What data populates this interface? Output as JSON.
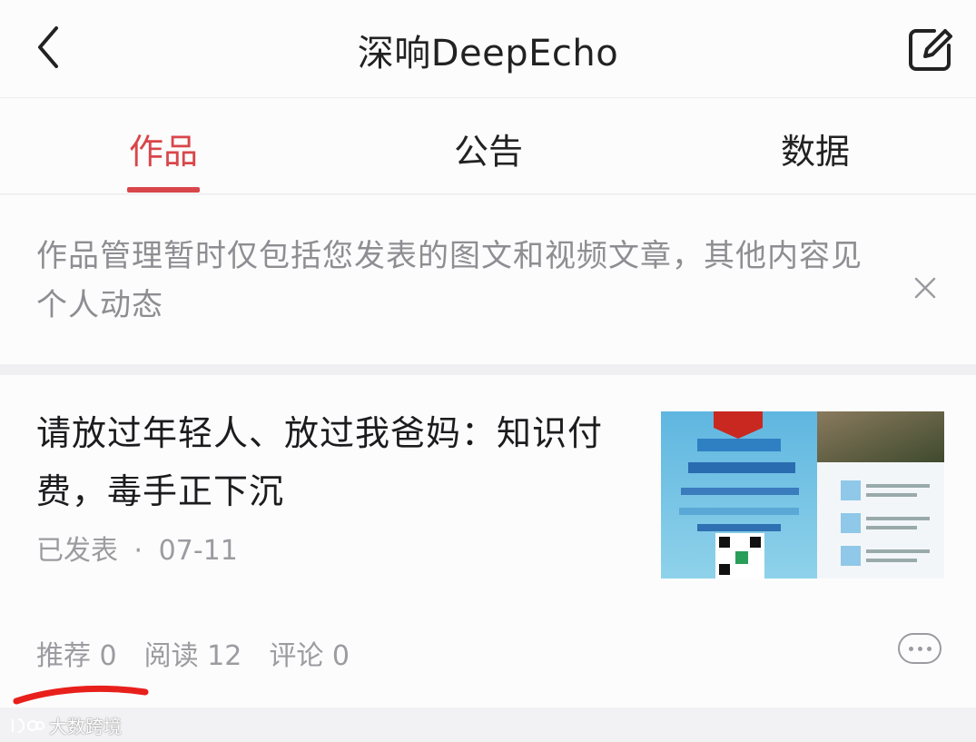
{
  "header": {
    "title": "深响DeepEcho",
    "back_icon": "chevron-left-icon",
    "edit_icon": "edit-icon"
  },
  "tabs": [
    {
      "label": "作品",
      "active": true
    },
    {
      "label": "公告",
      "active": false
    },
    {
      "label": "数据",
      "active": false
    }
  ],
  "notice": {
    "text": "作品管理暂时仅包括您发表的图文和视频文章，其他内容见个人动态",
    "close_icon": "close-icon"
  },
  "article": {
    "title": "请放过年轻人、放过我爸妈：知识付费，毒手正下沉",
    "status": "已发表",
    "separator": "·",
    "date": "07-11",
    "stats": {
      "recommend": "推荐 0",
      "read": "阅读 12",
      "comment": "评论 0"
    },
    "more_icon": "more-icon"
  },
  "watermark": {
    "text": "大数跨境"
  },
  "colors": {
    "accent": "#d9464a",
    "text_primary": "#1c1c1e",
    "text_secondary": "#9b9ba0",
    "annotation": "#e8201c"
  }
}
